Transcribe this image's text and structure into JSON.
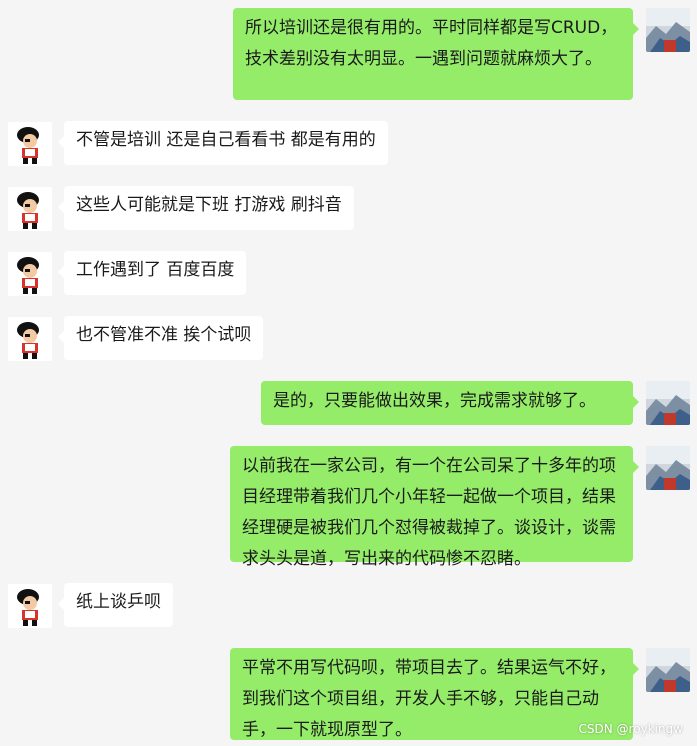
{
  "messages": [
    {
      "side": "out",
      "text": "所以培训还是很有用的。平时同样都是写CRUD，技术差别没有太明显。一遇到问题就麻烦大了。"
    },
    {
      "side": "in",
      "text": "不管是培训 还是自己看看书 都是有用的"
    },
    {
      "side": "in",
      "text": "这些人可能就是下班 打游戏 刷抖音"
    },
    {
      "side": "in",
      "text": "工作遇到了 百度百度"
    },
    {
      "side": "in",
      "text": "也不管准不准 挨个试呗"
    },
    {
      "side": "out",
      "text": "是的，只要能做出效果，完成需求就够了。"
    },
    {
      "side": "out",
      "text": "以前我在一家公司，有一个在公司呆了十多年的项目经理带着我们几个小年轻一起做一个项目，结果经理硬是被我们几个怼得被裁掉了。谈设计，谈需求头头是道，写出来的代码惨不忍睹。"
    },
    {
      "side": "in",
      "text": "纸上谈乒呗"
    },
    {
      "side": "out",
      "text": "平常不用写代码呗，带项目去了。结果运气不好，到我们这个项目组，开发人手不够，只能自己动手，一下就现原型了。"
    }
  ],
  "watermark": "CSDN @roykingw",
  "colors": {
    "background": "#f5f5f5",
    "outgoing_bubble": "#95ec69",
    "incoming_bubble": "#ffffff"
  },
  "icons": {
    "incoming_avatar": "cartoon-character-avatar-icon",
    "outgoing_avatar": "landscape-photo-avatar-icon"
  }
}
